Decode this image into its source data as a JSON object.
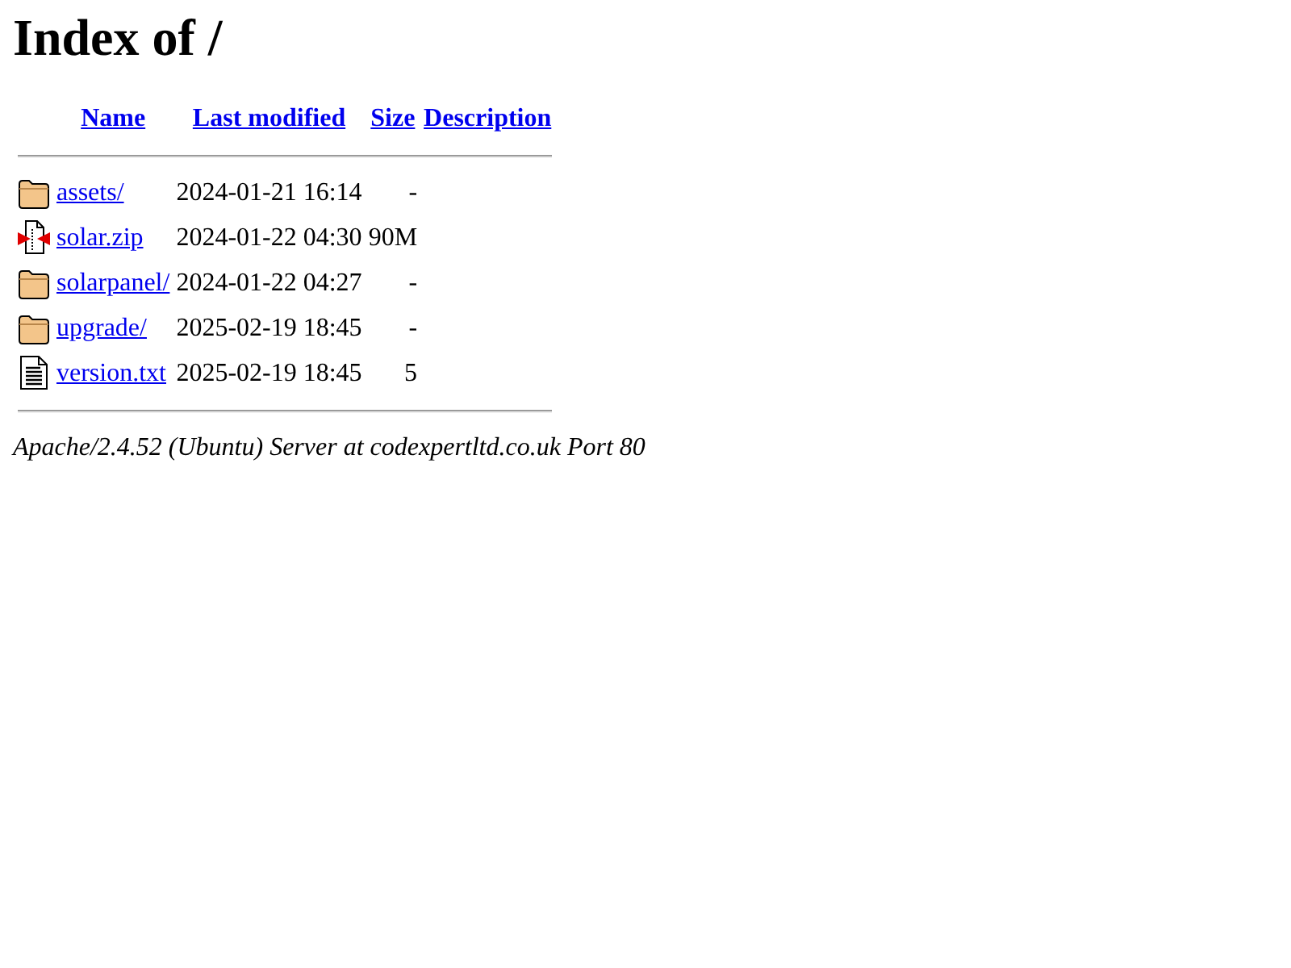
{
  "title": "Index of /",
  "columns": [
    "Name",
    "Last modified",
    "Size",
    "Description"
  ],
  "rows": [
    {
      "kind": "folder",
      "name": "assets/",
      "modified": "2024-01-21 16:14",
      "size": "-"
    },
    {
      "kind": "compressed",
      "name": "solar.zip",
      "modified": "2024-01-22 04:30",
      "size": "90M"
    },
    {
      "kind": "folder",
      "name": "solarpanel/",
      "modified": "2024-01-22 04:27",
      "size": "-"
    },
    {
      "kind": "folder",
      "name": "upgrade/",
      "modified": "2025-02-19 18:45",
      "size": "-"
    },
    {
      "kind": "text",
      "name": "version.txt",
      "modified": "2025-02-19 18:45",
      "size": "5"
    }
  ],
  "address": "Apache/2.4.52 (Ubuntu) Server at codexpertltd.co.uk Port 80"
}
